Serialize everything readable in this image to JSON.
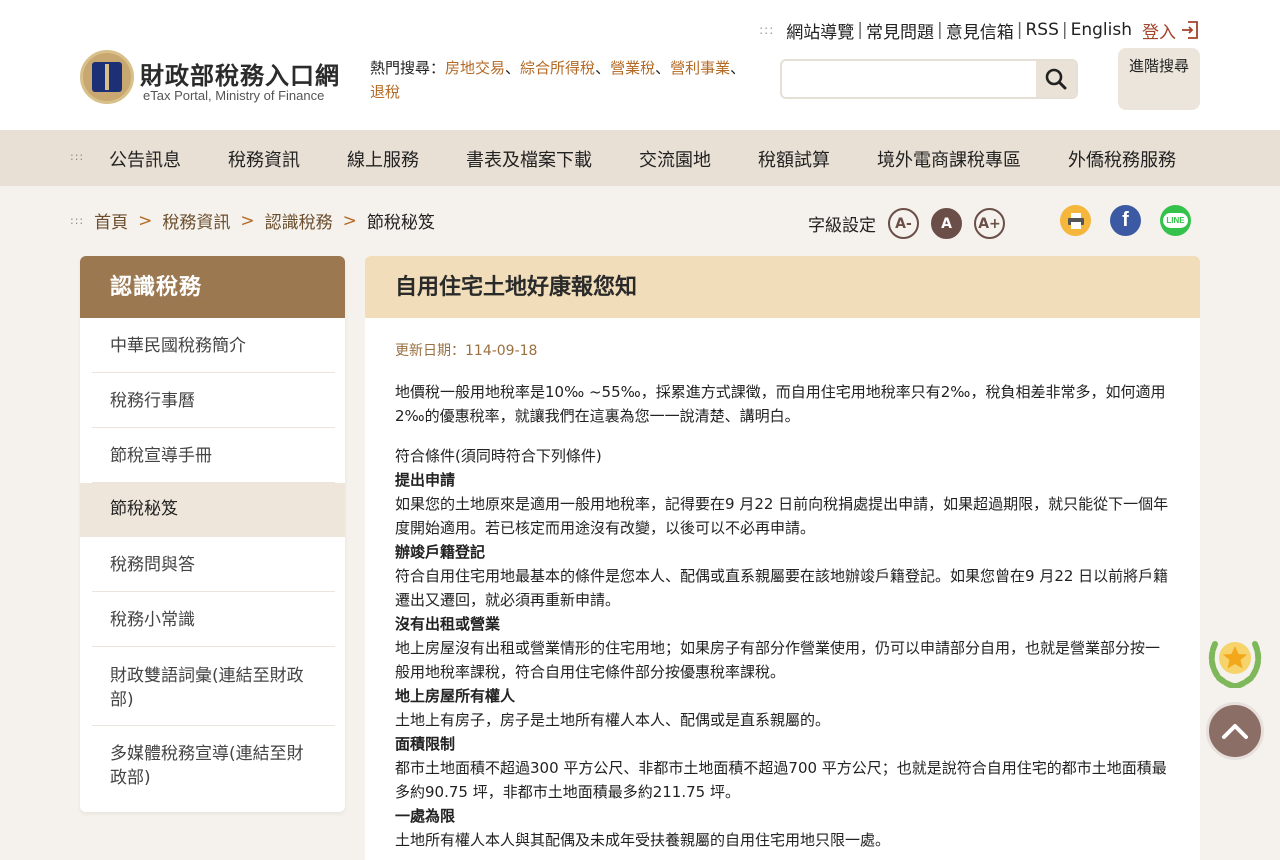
{
  "site": {
    "name": "財政部稅務入口網",
    "subtitle": "eTax Portal, Ministry of Finance"
  },
  "toplinks": [
    {
      "label": "網站導覽"
    },
    {
      "label": "常見問題"
    },
    {
      "label": "意見信箱"
    },
    {
      "label": "RSS"
    },
    {
      "label": "English"
    }
  ],
  "login_label": "登入",
  "hot_search": {
    "label": "熱門搜尋：",
    "keywords": [
      "房地交易",
      "綜合所得稅",
      "營業稅",
      "營利事業",
      "退稅"
    ],
    "separator": "、"
  },
  "search": {
    "placeholder": "",
    "value": ""
  },
  "advanced_search_label": "進階搜尋",
  "nav": [
    {
      "label": "公告訊息"
    },
    {
      "label": "稅務資訊"
    },
    {
      "label": "線上服務"
    },
    {
      "label": "書表及檔案下載"
    },
    {
      "label": "交流園地"
    },
    {
      "label": "稅額試算"
    },
    {
      "label": "境外電商課稅專區"
    },
    {
      "label": "外僑稅務服務"
    }
  ],
  "breadcrumb": {
    "items": [
      "首頁",
      "稅務資訊",
      "認識稅務"
    ],
    "current": "節稅秘笈",
    "arrow": ">"
  },
  "font_setting": {
    "label": "字級設定",
    "buttons": [
      "A-",
      "A",
      "A+"
    ],
    "active_index": 1
  },
  "share": {
    "print_icon": "printer-icon",
    "facebook_icon": "facebook-icon",
    "line_icon": "line-icon",
    "line_text": "LINE",
    "facebook_text": "f"
  },
  "sidebar": {
    "title": "認識稅務",
    "items": [
      {
        "label": "中華民國稅務簡介"
      },
      {
        "label": "稅務行事曆"
      },
      {
        "label": "節稅宣導手冊"
      },
      {
        "label": "節稅秘笈",
        "active": true
      },
      {
        "label": "稅務問與答"
      },
      {
        "label": "稅務小常識"
      },
      {
        "label": "財政雙語詞彙(連結至財政部)"
      },
      {
        "label": "多媒體稅務宣導(連結至財政部)"
      }
    ]
  },
  "article": {
    "title": "自用住宅土地好康報您知",
    "updated": "更新日期：114-09-18",
    "intro": "地價稅一般用地稅率是10‰ ~55‰，採累進方式課徵，而自用住宅用地稅率只有2‰，稅負相差非常多，如何適用2‰的優惠稅率，就讓我們在這裏為您一一說清楚、講明白。",
    "conditions_intro": "符合條件(須同時符合下列條件)",
    "sections": [
      {
        "heading": "提出申請",
        "text": "如果您的土地原來是適用一般用地稅率，記得要在9 月22 日前向稅捐處提出申請，如果超過期限，就只能從下一個年度開始適用。若已核定而用途沒有改變，以後可以不必再申請。"
      },
      {
        "heading": "辦竣戶籍登記",
        "text": "符合自用住宅用地最基本的條件是您本人、配偶或直系親屬要在該地辦竣戶籍登記。如果您曾在9 月22 日以前將戶籍遷出又遷回，就必須再重新申請。"
      },
      {
        "heading": "沒有出租或營業",
        "text": "地上房屋沒有出租或營業情形的住宅用地；如果房子有部分作營業使用，仍可以申請部分自用，也就是營業部分按一般用地稅率課稅，符合自用住宅條件部分按優惠稅率課稅。"
      },
      {
        "heading": "地上房屋所有權人",
        "text": "土地上有房子，房子是土地所有權人本人、配偶或是直系親屬的。"
      },
      {
        "heading": "面積限制",
        "text": "都市土地面積不超過300 平方公尺、非都市土地面積不超過700 平方公尺；也就是說符合自用住宅的都市土地面積最多約90.75 坪，非都市土地面積最多約211.75 坪。"
      },
      {
        "heading": "一處為限",
        "text": "土地所有權人本人與其配偶及未成年受扶養親屬的自用住宅用地只限一處。"
      }
    ]
  },
  "colors": {
    "accent": "#9b7850",
    "title_bg": "#f1ddb9",
    "keyword": "#b46a24",
    "login": "#a0442a"
  }
}
